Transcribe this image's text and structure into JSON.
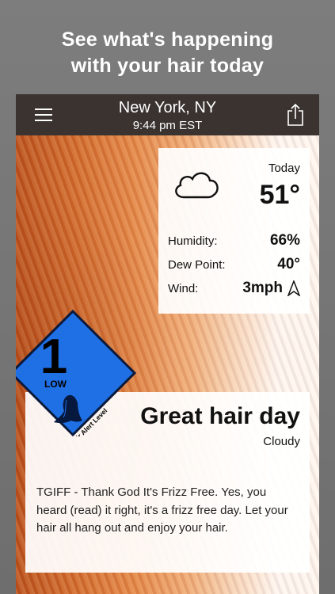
{
  "promo": {
    "line1": "See what's happening",
    "line2": "with your hair today"
  },
  "header": {
    "city": "New York, NY",
    "time": "9:44 pm EST"
  },
  "weather": {
    "day_label": "Today",
    "temperature": "51°",
    "condition_icon": "cloud-icon",
    "rows": [
      {
        "label": "Humidity:",
        "value": "66%"
      },
      {
        "label": "Dew Point:",
        "value": "40°"
      },
      {
        "label": "Wind:",
        "value": "3mph"
      }
    ]
  },
  "hair_alert": {
    "level": "1",
    "level_text": "LOW",
    "caption": "Hair Alert Level",
    "color": "#1f6fe5"
  },
  "forecast": {
    "headline": "Great hair day",
    "condition": "Cloudy",
    "description": "TGIFF - Thank God It's Frizz Free.  Yes, you heard (read) it right, it's a frizz free day.  Let your hair all hang out and enjoy your hair."
  }
}
